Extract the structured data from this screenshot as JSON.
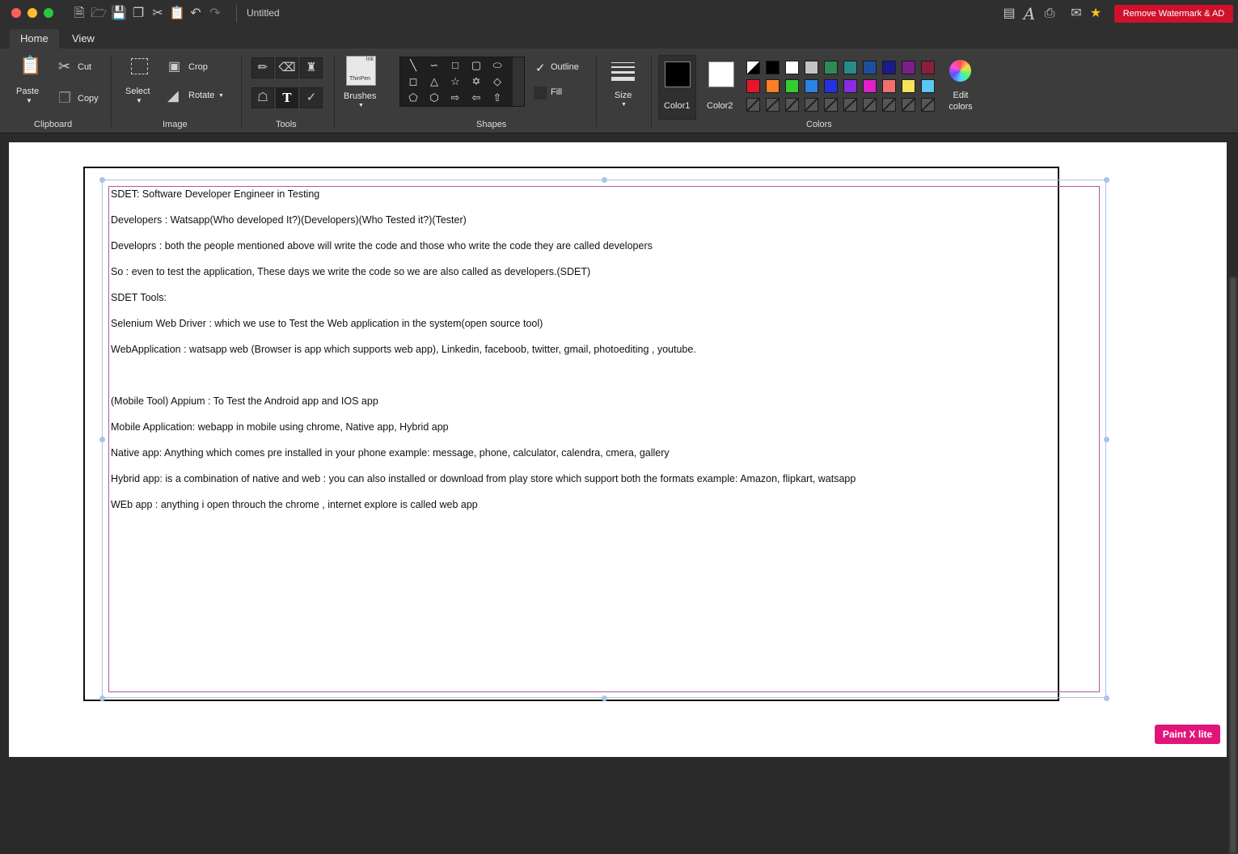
{
  "window": {
    "title": "Untitled",
    "watermark_button": "Remove Watermark & AD",
    "brand_badge": "Paint X lite"
  },
  "tabs": [
    "Home",
    "View"
  ],
  "ribbon": {
    "clipboard": {
      "group": "Clipboard",
      "paste": "Paste",
      "cut": "Cut",
      "copy": "Copy"
    },
    "image": {
      "group": "Image",
      "select": "Select",
      "crop": "Crop",
      "rotate": "Rotate"
    },
    "tools": {
      "group": "Tools"
    },
    "brushes": {
      "label": "Brushes",
      "preview_text": "ThinPen",
      "preview_tag": "Ink"
    },
    "shapes": {
      "group": "Shapes",
      "outline": "Outline",
      "fill": "Fill"
    },
    "size": {
      "label": "Size"
    },
    "color1": {
      "label": "Color1",
      "value": "#000000"
    },
    "color2": {
      "label": "Color2",
      "value": "#ffffff"
    },
    "colors": {
      "group": "Colors",
      "edit": "Edit colors"
    }
  },
  "palette": [
    [
      "#ffffff",
      "#000000",
      "#ffffff",
      "#c3c3c3",
      "#2e8b57",
      "#2a8a8a",
      "#1f4e9e",
      "#1a1a8c",
      "#7a1f8a",
      "#8a1f3c"
    ],
    [
      "#e8162b",
      "#ff7f27",
      "#33cc33",
      "#2a82e4",
      "#2233dd",
      "#8a2be2",
      "#e020c8",
      "#f07070",
      "#f5e35a",
      "#5ac8f0"
    ]
  ],
  "document": {
    "lines": [
      "SDET: Software Developer Engineer in Testing",
      "Developers : Watsapp(Who developed It?)(Developers)(Who Tested it?)(Tester)",
      "Developrs : both the people mentioned above will write the code and those who write the code they are called developers",
      "So : even to test the application, These days we write the code so we are also called as developers.(SDET)",
      "SDET Tools:",
      "Selenium Web Driver : which we use to Test the Web application in the system(open source tool)",
      "WebApplication : watsapp web (Browser is app which supports web app), Linkedin, faceboob, twitter, gmail, photoediting , youtube.",
      "",
      "(Mobile Tool) Appium : To Test the Android app and IOS app",
      "Mobile Application: webapp in mobile using chrome, Native app, Hybrid app",
      "Native app: Anything which comes pre installed in your phone example: message, phone, calculator, calendra, cmera, gallery",
      "Hybrid app: is a combination of native and web : you can also installed or download from play store which support both the formats example: Amazon, flipkart, watsapp",
      "WEb app : anything i open throuch the chrome , internet explore is called web app"
    ]
  }
}
